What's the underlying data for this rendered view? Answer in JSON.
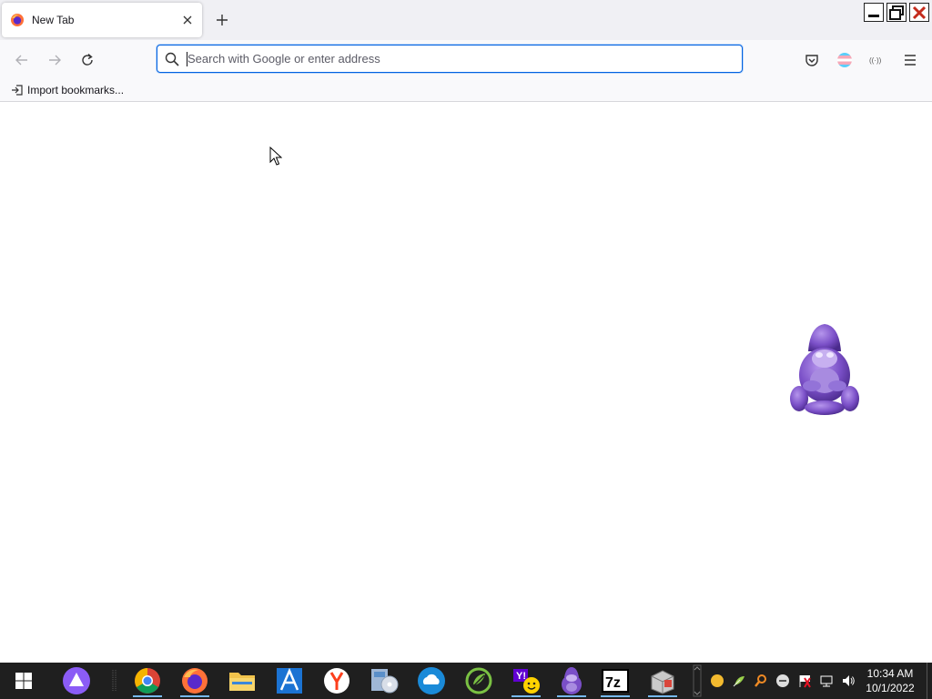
{
  "browser": {
    "tab": {
      "title": "New Tab"
    },
    "urlbar": {
      "placeholder": "Search with Google or enter address",
      "value": ""
    },
    "bookmarks": [
      {
        "label": "Import bookmarks..."
      }
    ]
  },
  "taskbar": {
    "apps": [
      {
        "name": "start",
        "icon": "windows-logo-icon"
      },
      {
        "name": "alice",
        "icon": "alice-assistant-icon"
      },
      {
        "name": "chrome",
        "icon": "chrome-icon"
      },
      {
        "name": "firefox",
        "icon": "firefox-icon"
      },
      {
        "name": "file-explorer",
        "icon": "folder-icon"
      },
      {
        "name": "arc",
        "icon": "arc-browser-icon"
      },
      {
        "name": "yandex",
        "icon": "yandex-icon"
      },
      {
        "name": "media",
        "icon": "media-disc-icon"
      },
      {
        "name": "cloud",
        "icon": "cloud-icon"
      },
      {
        "name": "green-app",
        "icon": "green-leaf-icon"
      },
      {
        "name": "yahoo-messenger",
        "icon": "yahoo-messenger-icon"
      },
      {
        "name": "bonzi-buddy",
        "icon": "bonzi-icon"
      },
      {
        "name": "7zip",
        "icon": "7zip-icon"
      },
      {
        "name": "installer",
        "icon": "installer-box-icon"
      }
    ],
    "clock": {
      "time": "10:34 AM",
      "date": "10/1/2022"
    }
  },
  "colors": {
    "accent": "#0061e0",
    "taskbar": "#1f1f1f",
    "tabstrip": "#f0f0f4",
    "bonzi": "#7a4fc7"
  }
}
